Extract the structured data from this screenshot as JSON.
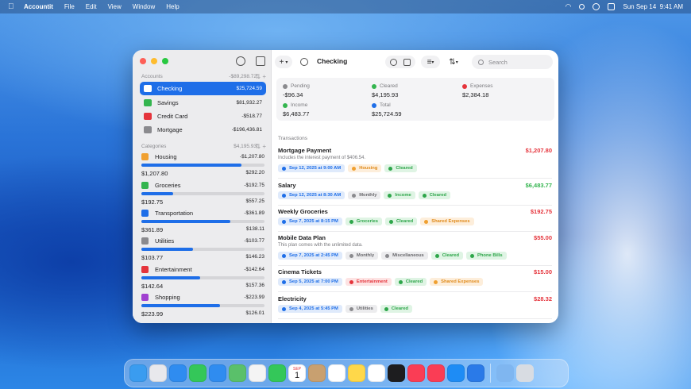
{
  "menubar": {
    "app_name": "Accountit",
    "menus": [
      "File",
      "Edit",
      "View",
      "Window",
      "Help"
    ],
    "clock": "Sun Sep 14  9:41 AM"
  },
  "sidebar": {
    "accounts_header": "Accounts",
    "accounts_total": "-$89,298.72",
    "accounts": [
      {
        "name": "Checking",
        "balance": "$25,724.59",
        "icon": "bank-icon",
        "color": "#1e6ee8"
      },
      {
        "name": "Savings",
        "balance": "$81,932.27",
        "icon": "savings-icon",
        "color": "#34b54f"
      },
      {
        "name": "Credit Card",
        "balance": "-$518.77",
        "icon": "credit-card-icon",
        "color": "#e5343c"
      },
      {
        "name": "Mortgage",
        "balance": "-$196,436.81",
        "icon": "house-icon",
        "color": "#8a8a8e"
      }
    ],
    "categories_header": "Categories",
    "categories_total": "$4,195.93",
    "categories": [
      {
        "name": "Housing",
        "spent": "-$1,207.80",
        "amount": "$1,207.80",
        "budget": "$292.20",
        "progress": 0.81,
        "icon": "housing-icon",
        "color": "#f0a030"
      },
      {
        "name": "Groceries",
        "spent": "-$192.75",
        "amount": "$192.75",
        "budget": "$557.25",
        "progress": 0.26,
        "icon": "groceries-icon",
        "color": "#34b54f"
      },
      {
        "name": "Transportation",
        "spent": "-$361.89",
        "amount": "$361.89",
        "budget": "$138.11",
        "progress": 0.72,
        "icon": "car-icon",
        "color": "#1e6ee8"
      },
      {
        "name": "Utilities",
        "spent": "-$103.77",
        "amount": "$103.77",
        "budget": "$146.23",
        "progress": 0.42,
        "icon": "gear-icon",
        "color": "#8a8a8e"
      },
      {
        "name": "Entertainment",
        "spent": "-$142.64",
        "amount": "$142.64",
        "budget": "$157.36",
        "progress": 0.48,
        "icon": "entertainment-icon",
        "color": "#e5343c"
      },
      {
        "name": "Shopping",
        "spent": "-$223.99",
        "amount": "$223.99",
        "budget": "$126.01",
        "progress": 0.64,
        "icon": "cart-icon",
        "color": "#a040d0"
      }
    ]
  },
  "toolbar": {
    "add_label": "+",
    "title": "Checking",
    "search_placeholder": "Search"
  },
  "summary": {
    "pending_label": "Pending",
    "pending_value": "-$96.34",
    "cleared_label": "Cleared",
    "cleared_value": "$4,195.93",
    "expenses_label": "Expenses",
    "expenses_value": "$2,384.18",
    "income_label": "Income",
    "income_value": "$6,483.77",
    "total_label": "Total",
    "total_value": "$25,724.59"
  },
  "transactions_header": "Transactions",
  "transactions": [
    {
      "name": "Mortgage Payment",
      "amount": "$1,207.80",
      "note": "Includes the interest payment of $406.54.",
      "tags": [
        {
          "text": "Sep 12, 2025 at 9:00 AM",
          "kind": "date"
        },
        {
          "text": "Housing",
          "kind": "orange"
        },
        {
          "text": "Cleared",
          "kind": "cleared"
        }
      ]
    },
    {
      "name": "Salary",
      "amount": "$6,483.77",
      "note": "",
      "tags": [
        {
          "text": "Sep 12, 2025 at 8:30 AM",
          "kind": "date"
        },
        {
          "text": "Monthly",
          "kind": "gray"
        },
        {
          "text": "Income",
          "kind": "cleared"
        },
        {
          "text": "Cleared",
          "kind": "cleared"
        }
      ]
    },
    {
      "name": "Weekly Groceries",
      "amount": "$192.75",
      "note": "",
      "tags": [
        {
          "text": "Sep 7, 2025 at 8:15 PM",
          "kind": "date"
        },
        {
          "text": "Groceries",
          "kind": "cleared"
        },
        {
          "text": "Cleared",
          "kind": "cleared"
        },
        {
          "text": "Shared Expenses",
          "kind": "orange"
        }
      ]
    },
    {
      "name": "Mobile Data Plan",
      "amount": "$55.00",
      "note": "This plan comes with the unlimited data.",
      "tags": [
        {
          "text": "Sep 7, 2025 at 2:45 PM",
          "kind": "date"
        },
        {
          "text": "Monthly",
          "kind": "gray"
        },
        {
          "text": "Miscellaneous",
          "kind": "gray"
        },
        {
          "text": "Cleared",
          "kind": "cleared"
        },
        {
          "text": "Phone Bills",
          "kind": "cleared"
        }
      ]
    },
    {
      "name": "Cinema Tickets",
      "amount": "$15.00",
      "note": "",
      "tags": [
        {
          "text": "Sep 5, 2025 at 7:00 PM",
          "kind": "date"
        },
        {
          "text": "Entertainment",
          "kind": "red"
        },
        {
          "text": "Cleared",
          "kind": "cleared"
        },
        {
          "text": "Shared Expenses",
          "kind": "orange"
        }
      ]
    },
    {
      "name": "Electricity",
      "amount": "$28.32",
      "note": "",
      "tags": [
        {
          "text": "Sep 4, 2025 at 5:45 PM",
          "kind": "date"
        },
        {
          "text": "Utilities",
          "kind": "gray"
        },
        {
          "text": "Cleared",
          "kind": "cleared"
        }
      ]
    }
  ],
  "dock": {
    "apps": [
      {
        "name": "finder-icon",
        "color": "#3a9cf0"
      },
      {
        "name": "launchpad-icon",
        "color": "#e8e8ec"
      },
      {
        "name": "safari-icon",
        "color": "#2f8cf0"
      },
      {
        "name": "messages-icon",
        "color": "#34c759"
      },
      {
        "name": "mail-icon",
        "color": "#2f8cf0"
      },
      {
        "name": "maps-icon",
        "color": "#5ac06a"
      },
      {
        "name": "photos-icon",
        "color": "#f4f4f4"
      },
      {
        "name": "facetime-icon",
        "color": "#34c759"
      },
      {
        "name": "calendar-icon",
        "color": "#ffffff"
      },
      {
        "name": "contacts-icon",
        "color": "#c8a070"
      },
      {
        "name": "reminders-icon",
        "color": "#ffffff"
      },
      {
        "name": "notes-icon",
        "color": "#ffd84a"
      },
      {
        "name": "freeform-icon",
        "color": "#ffffff"
      },
      {
        "name": "tv-icon",
        "color": "#1d1d1f"
      },
      {
        "name": "music-icon",
        "color": "#fa3d55"
      },
      {
        "name": "news-icon",
        "color": "#fa3d55"
      },
      {
        "name": "app-store-icon",
        "color": "#1e8cf5"
      },
      {
        "name": "accountit-icon",
        "color": "#2a7ae8"
      }
    ],
    "calendar_month": "SEP",
    "calendar_day": "1",
    "extras": [
      {
        "name": "folder-icon",
        "color": "#7fb6f0"
      },
      {
        "name": "trash-icon",
        "color": "#d8dce2"
      }
    ]
  }
}
